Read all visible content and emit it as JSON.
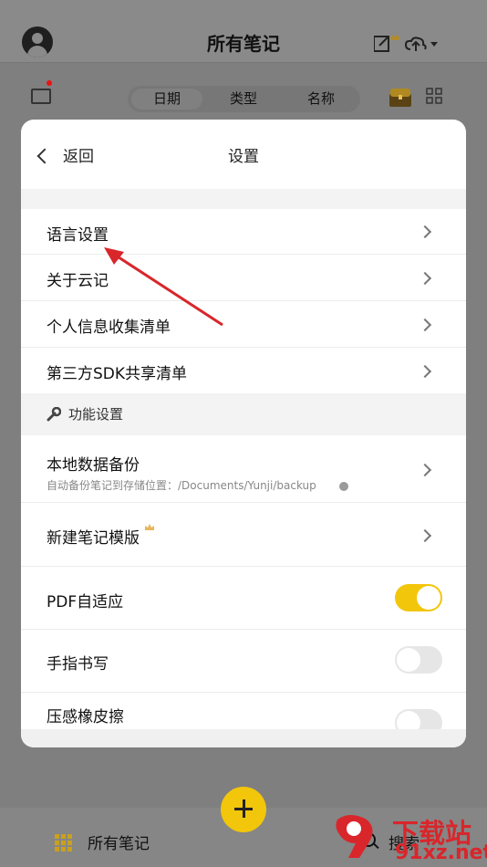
{
  "header": {
    "title": "所有笔记"
  },
  "tabs": [
    "日期",
    "类型",
    "名称"
  ],
  "modal": {
    "back_label": "返回",
    "title": "设置",
    "items": [
      {
        "label": "语言设置"
      },
      {
        "label": "关于云记"
      },
      {
        "label": "个人信息收集清单"
      },
      {
        "label": "第三方SDK共享清单"
      }
    ],
    "section": {
      "label": "功能设置"
    },
    "backup": {
      "label": "本地数据备份",
      "sub": "自动备份笔记到存储位置：/Documents/Yunji/backup"
    },
    "template": {
      "label": "新建笔记模版"
    },
    "pdf": {
      "label": "PDF自适应",
      "enabled": true
    },
    "finger": {
      "label": "手指书写",
      "enabled": false
    },
    "pressure": {
      "label": "压感橡皮擦",
      "enabled": false
    }
  },
  "bottom": {
    "all_notes": "所有笔记",
    "search": "搜索"
  },
  "watermark": {
    "text": "下载站",
    "url": "91xz.net"
  },
  "colors": {
    "accent": "#f2c60b",
    "annotation_arrow": "#d8262b"
  }
}
